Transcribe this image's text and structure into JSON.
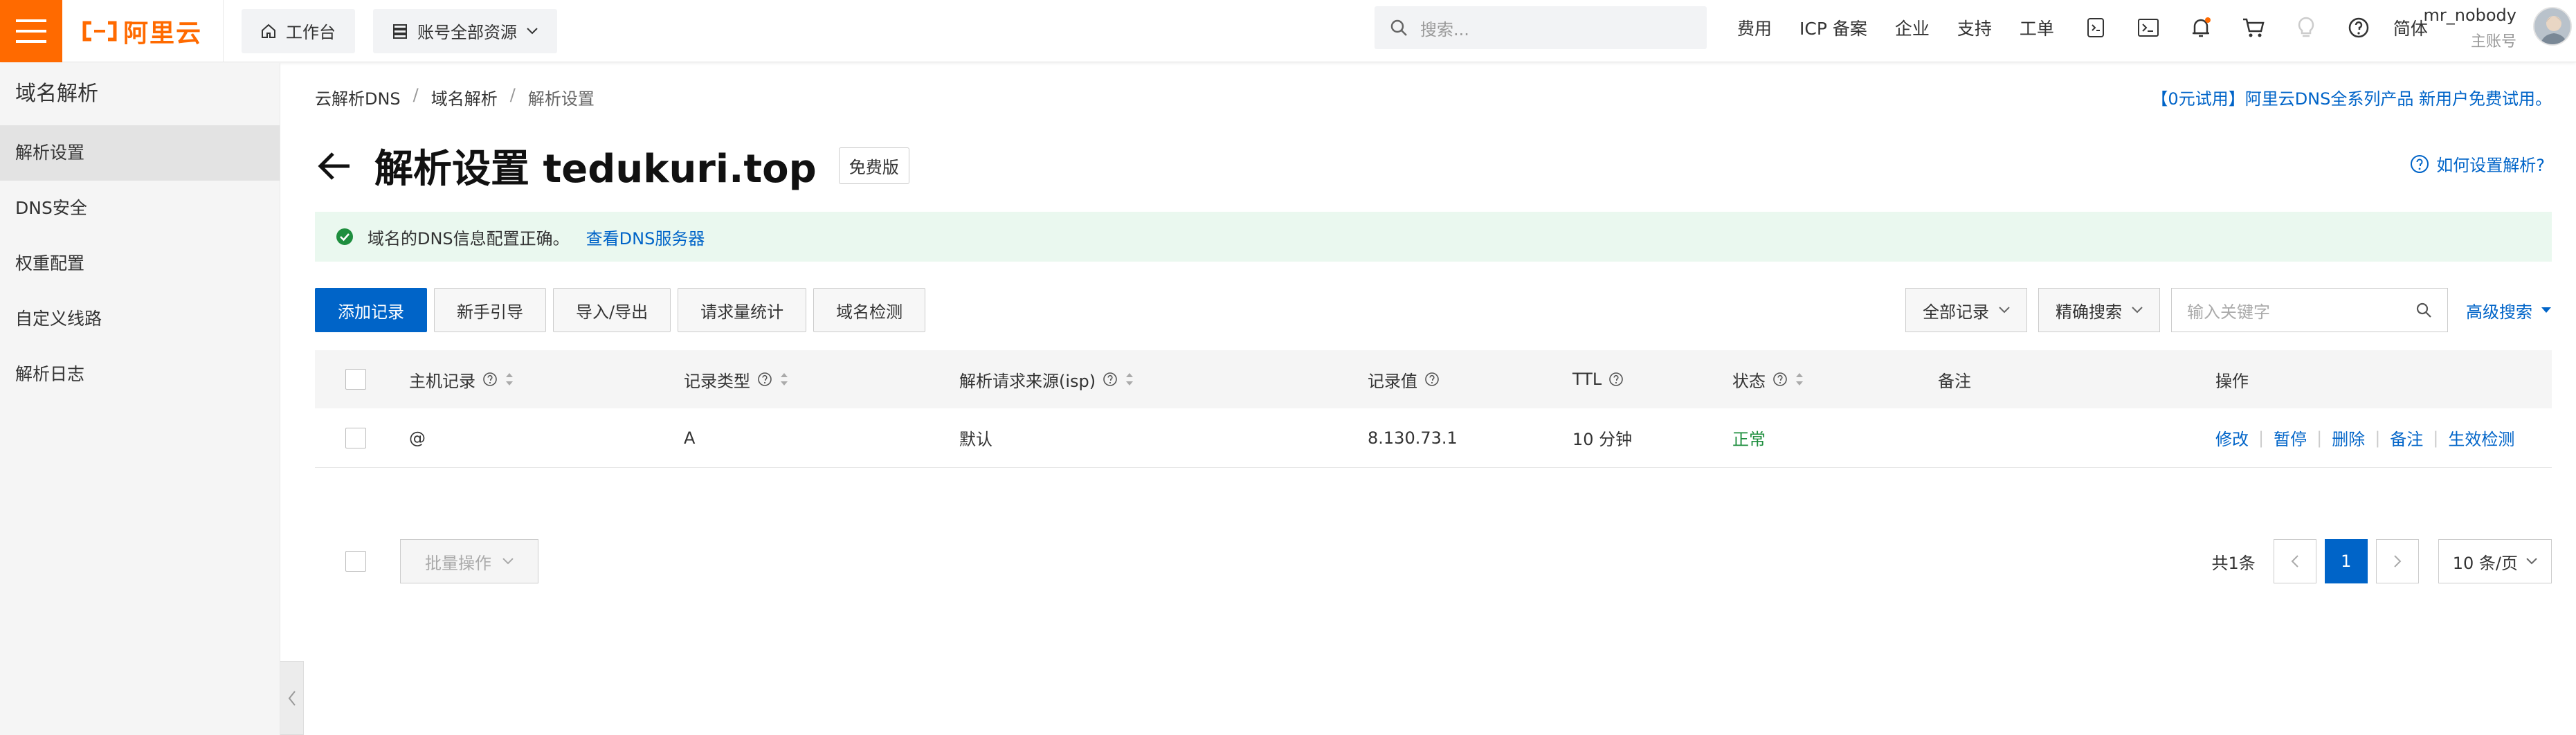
{
  "header": {
    "logo_text": "阿里云",
    "workbench_label": "工作台",
    "resource_label": "账号全部资源",
    "search_placeholder": "搜索...",
    "links": [
      "费用",
      "ICP 备案",
      "企业",
      "支持",
      "工单"
    ],
    "language_label": "简体",
    "user_name": "mr_nobody",
    "user_role": "主账号",
    "brand_color": "#ff6a00"
  },
  "sidebar": {
    "title": "域名解析",
    "items": [
      {
        "label": "解析设置",
        "active": true
      },
      {
        "label": "DNS安全",
        "active": false
      },
      {
        "label": "权重配置",
        "active": false
      },
      {
        "label": "自定义线路",
        "active": false
      },
      {
        "label": "解析日志",
        "active": false
      }
    ]
  },
  "breadcrumb": {
    "items": [
      "云解析DNS",
      "域名解析",
      "解析设置"
    ],
    "separator": "/"
  },
  "promo_text": "【0元试用】阿里云DNS全系列产品 新用户免费试用。",
  "page": {
    "title": "解析设置 tedukuri.top",
    "badge": "免费版",
    "help_link": "如何设置解析?"
  },
  "alert": {
    "message": "域名的DNS信息配置正确。",
    "link": "查看DNS服务器",
    "color": "#eaf8ef"
  },
  "toolbar": {
    "buttons": [
      "添加记录",
      "新手引导",
      "导入/导出",
      "请求量统计",
      "域名检测"
    ],
    "filter_all": "全部记录",
    "filter_match": "精确搜索",
    "keyword_placeholder": "输入关键字",
    "advanced_search": "高级搜索",
    "accent": "#0064c8"
  },
  "table": {
    "columns": [
      "主机记录",
      "记录类型",
      "解析请求来源(isp)",
      "记录值",
      "TTL",
      "状态",
      "备注",
      "操作"
    ],
    "rows": [
      {
        "host": "@",
        "type": "A",
        "isp": "默认",
        "value": "8.130.73.1",
        "ttl": "10 分钟",
        "status": "正常",
        "remark": "",
        "actions": [
          "修改",
          "暂停",
          "删除",
          "备注",
          "生效检测"
        ]
      }
    ]
  },
  "footer": {
    "batch_label": "批量操作",
    "total_label": "共1条",
    "current_page": "1",
    "page_size": "10 条/页"
  }
}
